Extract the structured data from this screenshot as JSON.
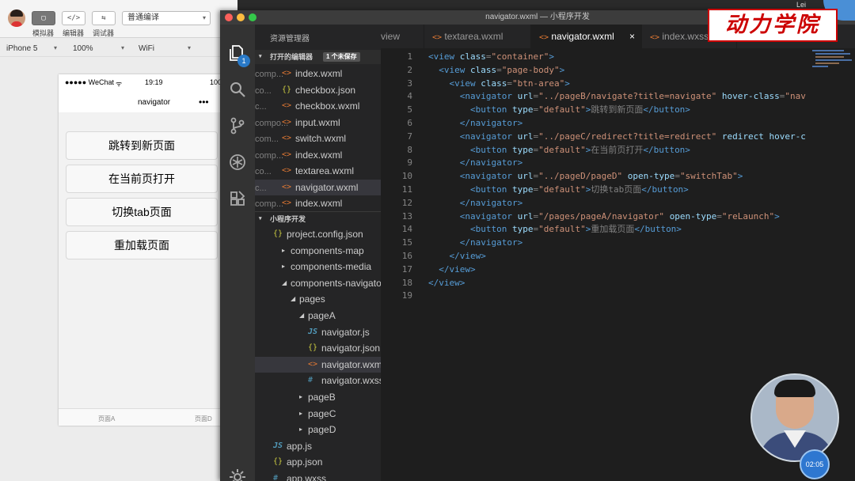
{
  "simulator": {
    "toolbar": {
      "simulator_label": "模拟器",
      "editor_label": "编辑器",
      "debugger_label": "调试器",
      "compile_mode": "普通编译",
      "simulator_glyph": "▢",
      "editor_glyph": "</>",
      "debugger_glyph": "⇆"
    },
    "device": "iPhone 5",
    "zoom": "100%",
    "network": "WiFi",
    "status": {
      "carrier": "●●●●● WeChat",
      "wifi": "ᯤ",
      "time": "19:19",
      "battery": "100"
    },
    "nav_title": "navigator",
    "nav_dots": "•••",
    "buttons": [
      "跳转到新页面",
      "在当前页打开",
      "切换tab页面",
      "重加载页面"
    ],
    "tabbar": [
      "页面A",
      "页面D"
    ]
  },
  "vscode": {
    "window_title": "navigator.wxml — 小程序开发",
    "activity_badge": "1",
    "explorer_title": "资源管理器",
    "open_editors": {
      "title": "打开的编辑器",
      "unsaved": "1 个未保存",
      "files": [
        {
          "icon": "xml",
          "name": "index.wxml",
          "dir": "comp..."
        },
        {
          "icon": "json",
          "name": "checkbox.json",
          "dir": "co..."
        },
        {
          "icon": "xml",
          "name": "checkbox.wxml",
          "dir": "c..."
        },
        {
          "icon": "xml",
          "name": "input.wxml",
          "dir": "compo..."
        },
        {
          "icon": "xml",
          "name": "switch.wxml",
          "dir": "com..."
        },
        {
          "icon": "xml",
          "name": "index.wxml",
          "dir": "comp..."
        },
        {
          "icon": "xml",
          "name": "textarea.wxml",
          "dir": "co..."
        },
        {
          "icon": "xml",
          "name": "navigator.wxml",
          "dir": "c..."
        },
        {
          "icon": "xml",
          "name": "index.wxml",
          "dir": "comp..."
        }
      ]
    },
    "project": {
      "title": "小程序开发",
      "tree": [
        {
          "type": "json",
          "name": "project.config.json"
        },
        {
          "type": "folder",
          "name": "components-map",
          "open": false
        },
        {
          "type": "folder",
          "name": "components-media",
          "open": false
        },
        {
          "type": "folder",
          "name": "components-navigator",
          "open": true
        },
        {
          "type": "folder",
          "name": "pages",
          "open": true
        },
        {
          "type": "folder",
          "name": "pageA",
          "open": true
        },
        {
          "type": "js",
          "name": "navigator.js"
        },
        {
          "type": "json",
          "name": "navigator.json"
        },
        {
          "type": "xml",
          "name": "navigator.wxml"
        },
        {
          "type": "wxss",
          "name": "navigator.wxss"
        },
        {
          "type": "folder",
          "name": "pageB",
          "open": false
        },
        {
          "type": "folder",
          "name": "pageC",
          "open": false
        },
        {
          "type": "folder",
          "name": "pageD",
          "open": false
        },
        {
          "type": "js",
          "name": "app.js"
        },
        {
          "type": "json",
          "name": "app.json"
        },
        {
          "type": "wxss",
          "name": "app.wxss"
        }
      ]
    },
    "tabs": [
      {
        "name": "view",
        "icon": ""
      },
      {
        "name": "textarea.wxml",
        "icon": "<>"
      },
      {
        "name": "navigator.wxml",
        "icon": "<>",
        "active": true,
        "close": "×"
      },
      {
        "name": "index.wxss",
        "icon": "<>"
      }
    ],
    "code": [
      [
        {
          "t": "t",
          "v": "<view "
        },
        {
          "t": "a",
          "v": "class"
        },
        {
          "t": "p",
          "v": "="
        },
        {
          "t": "s",
          "v": "\"container\""
        },
        {
          "t": "t",
          "v": ">"
        }
      ],
      [
        {
          "t": "p",
          "v": "  "
        },
        {
          "t": "t",
          "v": "<view "
        },
        {
          "t": "a",
          "v": "class"
        },
        {
          "t": "p",
          "v": "="
        },
        {
          "t": "s",
          "v": "\"page-body\""
        },
        {
          "t": "t",
          "v": ">"
        }
      ],
      [
        {
          "t": "p",
          "v": "    "
        },
        {
          "t": "t",
          "v": "<view "
        },
        {
          "t": "a",
          "v": "class"
        },
        {
          "t": "p",
          "v": "="
        },
        {
          "t": "s",
          "v": "\"btn-area\""
        },
        {
          "t": "t",
          "v": ">"
        }
      ],
      [
        {
          "t": "p",
          "v": "      "
        },
        {
          "t": "t",
          "v": "<navigator "
        },
        {
          "t": "a",
          "v": "url"
        },
        {
          "t": "p",
          "v": "="
        },
        {
          "t": "s",
          "v": "\"../pageB/navigate?title=navigate\""
        },
        {
          "t": "p",
          "v": " "
        },
        {
          "t": "a",
          "v": "hover-class"
        },
        {
          "t": "p",
          "v": "="
        },
        {
          "t": "s",
          "v": "\"nav"
        }
      ],
      [
        {
          "t": "p",
          "v": "        "
        },
        {
          "t": "t",
          "v": "<button "
        },
        {
          "t": "a",
          "v": "type"
        },
        {
          "t": "p",
          "v": "="
        },
        {
          "t": "s",
          "v": "\"default\""
        },
        {
          "t": "t",
          "v": ">"
        },
        {
          "t": "p",
          "v": "跳转到新页面"
        },
        {
          "t": "t",
          "v": "</button>"
        }
      ],
      [
        {
          "t": "p",
          "v": "      "
        },
        {
          "t": "t",
          "v": "</navigator>"
        }
      ],
      [
        {
          "t": "p",
          "v": "      "
        },
        {
          "t": "t",
          "v": "<navigator "
        },
        {
          "t": "a",
          "v": "url"
        },
        {
          "t": "p",
          "v": "="
        },
        {
          "t": "s",
          "v": "\"../pageC/redirect?title=redirect\""
        },
        {
          "t": "p",
          "v": " "
        },
        {
          "t": "a",
          "v": "redirect hover-c"
        }
      ],
      [
        {
          "t": "p",
          "v": "        "
        },
        {
          "t": "t",
          "v": "<button "
        },
        {
          "t": "a",
          "v": "type"
        },
        {
          "t": "p",
          "v": "="
        },
        {
          "t": "s",
          "v": "\"default\""
        },
        {
          "t": "t",
          "v": ">"
        },
        {
          "t": "p",
          "v": "在当前页打开"
        },
        {
          "t": "t",
          "v": "</button>"
        }
      ],
      [
        {
          "t": "p",
          "v": "      "
        },
        {
          "t": "t",
          "v": "</navigator>"
        }
      ],
      [
        {
          "t": "p",
          "v": "      "
        },
        {
          "t": "t",
          "v": "<navigator "
        },
        {
          "t": "a",
          "v": "url"
        },
        {
          "t": "p",
          "v": "="
        },
        {
          "t": "s",
          "v": "\"../pageD/pageD\""
        },
        {
          "t": "p",
          "v": " "
        },
        {
          "t": "a",
          "v": "open-type"
        },
        {
          "t": "p",
          "v": "="
        },
        {
          "t": "s",
          "v": "\"switchTab\""
        },
        {
          "t": "t",
          "v": ">"
        }
      ],
      [
        {
          "t": "p",
          "v": "        "
        },
        {
          "t": "t",
          "v": "<button "
        },
        {
          "t": "a",
          "v": "type"
        },
        {
          "t": "p",
          "v": "="
        },
        {
          "t": "s",
          "v": "\"default\""
        },
        {
          "t": "t",
          "v": ">"
        },
        {
          "t": "p",
          "v": "切换tab页面"
        },
        {
          "t": "t",
          "v": "</button>"
        }
      ],
      [
        {
          "t": "p",
          "v": "      "
        },
        {
          "t": "t",
          "v": "</navigator>"
        }
      ],
      [
        {
          "t": "p",
          "v": "      "
        },
        {
          "t": "t",
          "v": "<navigator "
        },
        {
          "t": "a",
          "v": "url"
        },
        {
          "t": "p",
          "v": "="
        },
        {
          "t": "s",
          "v": "\"/pages/pageA/navigator\""
        },
        {
          "t": "p",
          "v": " "
        },
        {
          "t": "a",
          "v": "open-type"
        },
        {
          "t": "p",
          "v": "="
        },
        {
          "t": "s",
          "v": "\"reLaunch\""
        },
        {
          "t": "t",
          "v": ">"
        }
      ],
      [
        {
          "t": "p",
          "v": "        "
        },
        {
          "t": "t",
          "v": "<button "
        },
        {
          "t": "a",
          "v": "type"
        },
        {
          "t": "p",
          "v": "="
        },
        {
          "t": "s",
          "v": "\"default\""
        },
        {
          "t": "t",
          "v": ">"
        },
        {
          "t": "p",
          "v": "重加载页面"
        },
        {
          "t": "t",
          "v": "</button>"
        }
      ],
      [
        {
          "t": "p",
          "v": "      "
        },
        {
          "t": "t",
          "v": "</navigator>"
        }
      ],
      [
        {
          "t": "p",
          "v": "    "
        },
        {
          "t": "t",
          "v": "</view>"
        }
      ],
      [
        {
          "t": "p",
          "v": "  "
        },
        {
          "t": "t",
          "v": "</view>"
        }
      ],
      [
        {
          "t": "t",
          "v": "</view>"
        }
      ],
      []
    ]
  },
  "overlay": {
    "logo_text": "动力学院",
    "user_name": "Lei",
    "timer": "02:05"
  },
  "colors": {
    "tag": "#569cd6",
    "attr": "#9cdcfe",
    "string": "#ce9178",
    "xml_icon": "#e37933",
    "json_icon": "#cbcb41",
    "js_icon": "#519aba"
  }
}
